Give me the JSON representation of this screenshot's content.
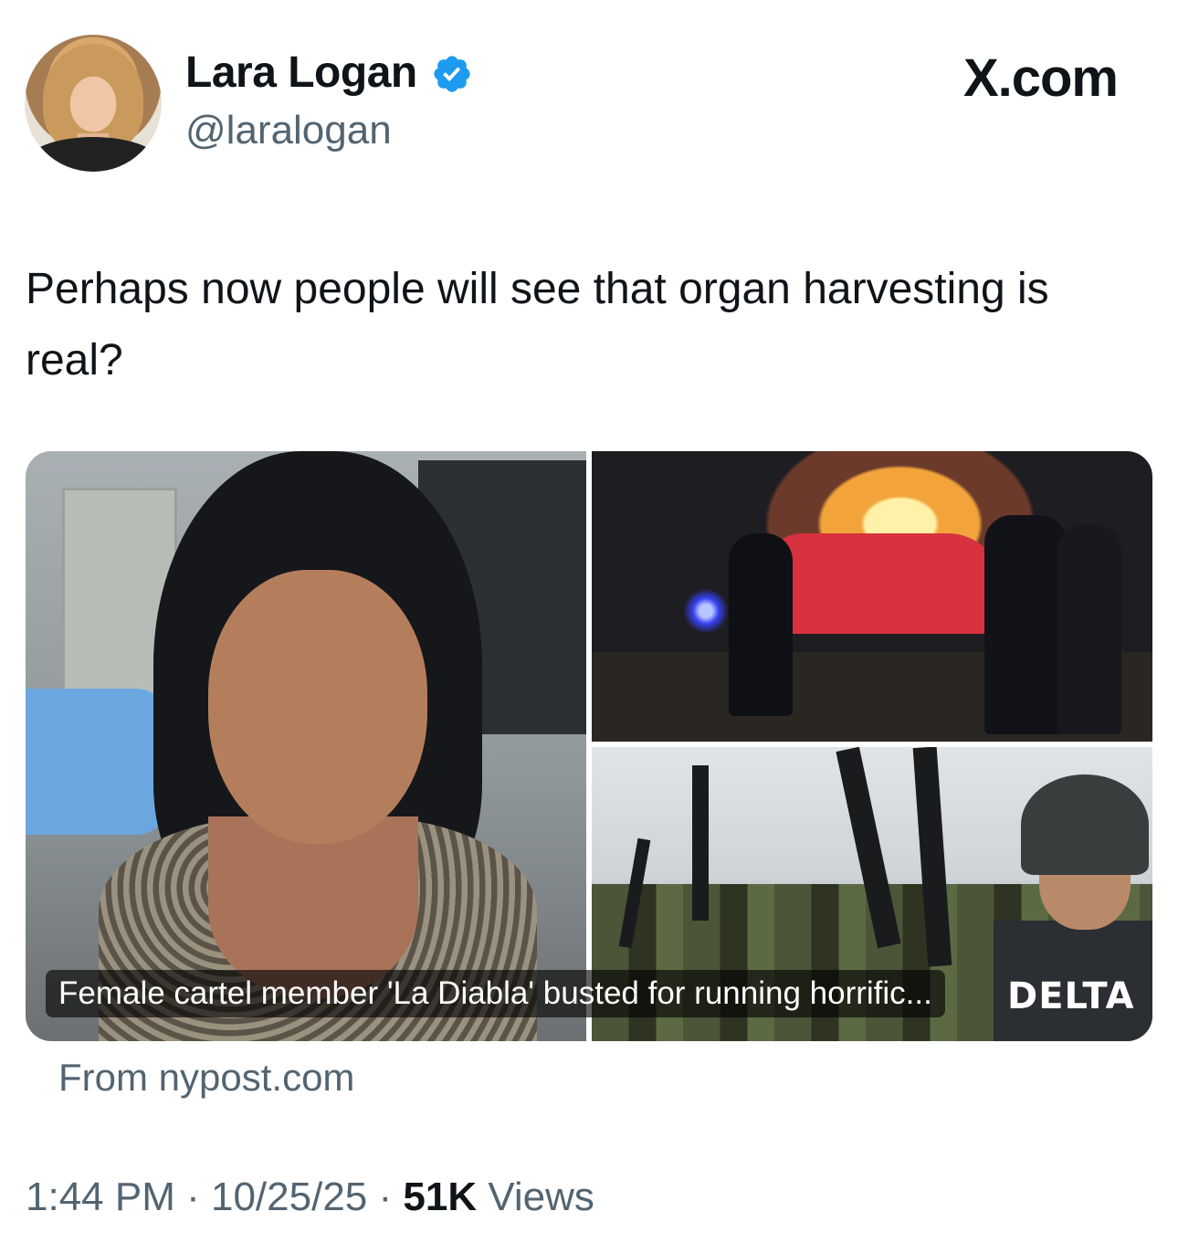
{
  "author": {
    "name": "Lara Logan",
    "handle": "@laralogan",
    "verified_icon": "verified-badge-icon",
    "verified_color": "#1d9bf0"
  },
  "brand": "X.com",
  "tweet": {
    "text": "Perhaps now people will see that organ harvesting is real?"
  },
  "link_card": {
    "caption": "Female cartel member 'La Diabla' busted for running horrific...",
    "image_badge": "DELTA",
    "source": "From nypost.com"
  },
  "meta": {
    "time": "1:44 PM",
    "sep1": " · ",
    "date": "10/25/25",
    "sep2": " · ",
    "views_count": "51K",
    "views_label": " Views"
  },
  "colors": {
    "text_primary": "#0f1419",
    "text_secondary": "#536471",
    "background": "#ffffff"
  }
}
